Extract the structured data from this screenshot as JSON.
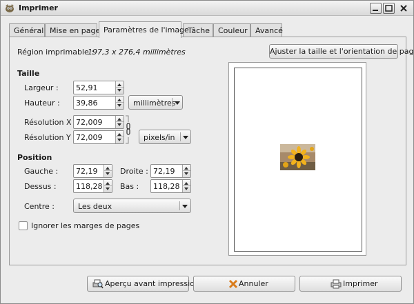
{
  "window": {
    "title": "Imprimer",
    "controls": {
      "minimize": "_",
      "maximize": "□",
      "close": "✕"
    }
  },
  "tabs": [
    {
      "label": "Général"
    },
    {
      "label": "Mise en page"
    },
    {
      "label": "Paramètres de l'image",
      "active": true
    },
    {
      "label": "Tâche"
    },
    {
      "label": "Couleur"
    },
    {
      "label": "Avancé"
    }
  ],
  "region": {
    "label": "Région imprimable :",
    "value": "197,3 x 276,4 millimètres",
    "fit_button": "Ajuster la taille et l'orientation de page"
  },
  "taille": {
    "heading": "Taille",
    "largeur_label": "Largeur :",
    "largeur_value": "52,91",
    "hauteur_label": "Hauteur :",
    "hauteur_value": "39,86",
    "unit": "millimètres",
    "resx_label": "Résolution X :",
    "resx_value": "72,009",
    "resy_label": "Résolution Y :",
    "resy_value": "72,009",
    "res_unit": "pixels/in"
  },
  "position": {
    "heading": "Position",
    "gauche_label": "Gauche :",
    "gauche_value": "72,19",
    "droite_label": "Droite :",
    "droite_value": "72,19",
    "dessus_label": "Dessus :",
    "dessus_value": "118,28",
    "bas_label": "Bas :",
    "bas_value": "118,28",
    "centre_label": "Centre :",
    "centre_value": "Les deux"
  },
  "ignore_margins": {
    "label": "Ignorer les marges de pages",
    "checked": false
  },
  "footer": {
    "preview_button": "Aperçu avant impression",
    "cancel_button": "Annuler",
    "print_button": "Imprimer"
  },
  "icons": [
    "gimp-icon",
    "chain-link-icon",
    "sunflower-thumbnail",
    "preview-icon",
    "cancel-icon",
    "printer-icon"
  ]
}
